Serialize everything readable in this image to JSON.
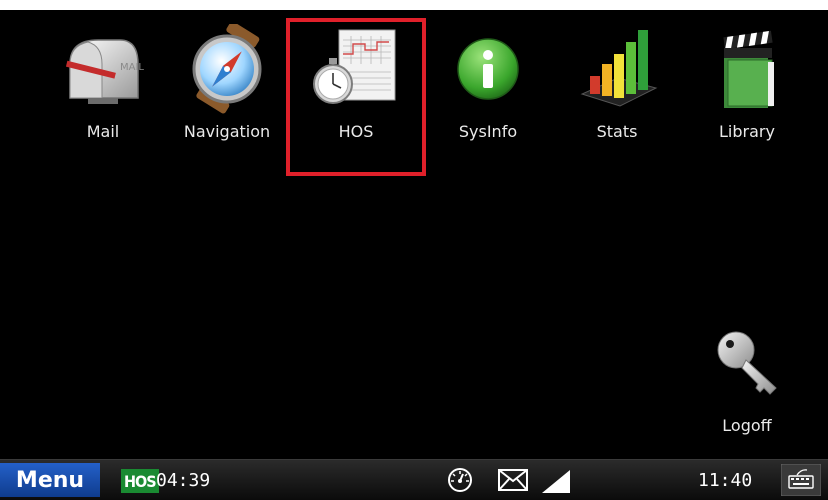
{
  "apps": [
    {
      "id": "mail",
      "label": "Mail",
      "icon": "mailbox-icon"
    },
    {
      "id": "navigation",
      "label": "Navigation",
      "icon": "compass-icon"
    },
    {
      "id": "hos",
      "label": "HOS",
      "icon": "stopwatch-logsheet-icon"
    },
    {
      "id": "sysinfo",
      "label": "SysInfo",
      "icon": "info-icon"
    },
    {
      "id": "stats",
      "label": "Stats",
      "icon": "bar-chart-icon"
    },
    {
      "id": "library",
      "label": "Library",
      "icon": "clapperboard-book-icon"
    }
  ],
  "mail_icon_text": "MAIL",
  "logoff": {
    "label": "Logoff",
    "icon": "key-icon"
  },
  "taskbar": {
    "menu_label": "Menu",
    "hos_badge": "HOS",
    "hos_time": "04:39",
    "clock": "11:40",
    "icons": [
      "speedometer-icon",
      "envelope-icon",
      "signal-icon",
      "keyboard-icon"
    ]
  },
  "colors": {
    "highlight": "#e0202a",
    "menu_blue": "#1a4fae",
    "hos_green": "#1a8a32"
  }
}
